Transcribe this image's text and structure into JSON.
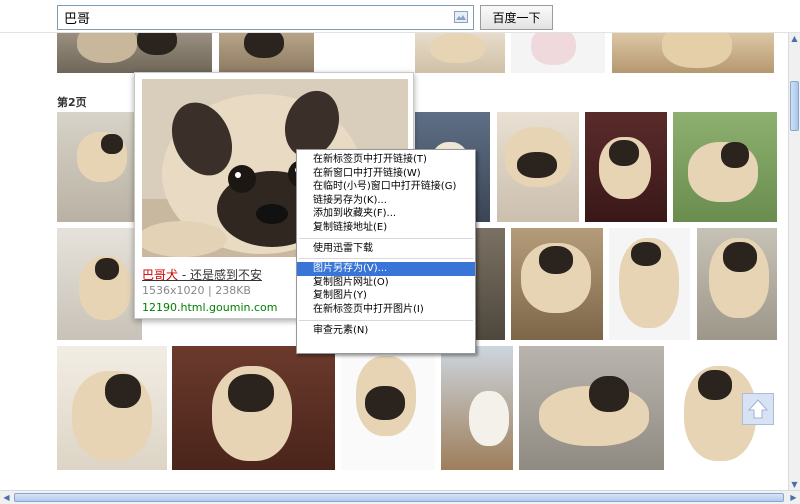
{
  "search": {
    "query": "巴哥",
    "button_label": "百度一下"
  },
  "results": {
    "page_label": "第2页"
  },
  "preview": {
    "title_highlight": "巴哥犬",
    "title_rest": " - 还是感到不安",
    "meta": "1536x1020 | 238KB",
    "url": "12190.html.goumin.com"
  },
  "context_menu": {
    "groups": [
      [
        "在新标签页中打开链接(T)",
        "在新窗口中打开链接(W)",
        "在临时(小号)窗口中打开链接(G)",
        "链接另存为(K)...",
        "添加到收藏夹(F)...",
        "复制链接地址(E)"
      ],
      [
        "使用迅雷下载"
      ],
      [
        "图片另存为(V)...",
        "复制图片网址(O)",
        "复制图片(Y)",
        "在新标签页中打开图片(I)"
      ],
      [
        "审查元素(N)"
      ]
    ],
    "selected": "图片另存为(V)..."
  },
  "icons": {
    "camera": "camera-search-icon",
    "back_to_top": "arrow-up-icon"
  },
  "colors": {
    "menu_highlight": "#3875d7",
    "url_green": "#008000",
    "title_red": "#cc0000"
  }
}
